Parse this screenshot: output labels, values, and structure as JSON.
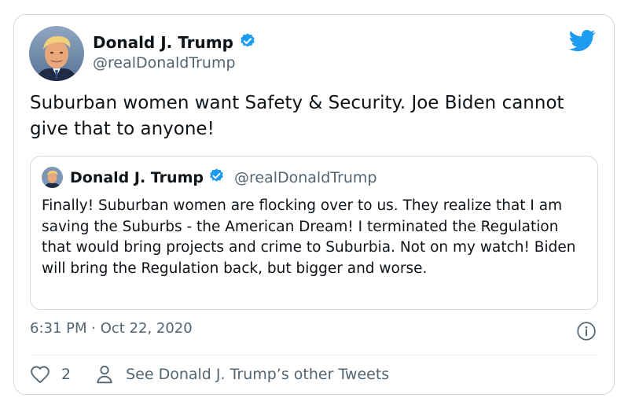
{
  "tweet": {
    "author_name": "Donald J. Trump",
    "author_handle": "@realDonaldTrump",
    "verified": true,
    "text": "Suburban women want Safety & Security. Joe Biden cannot give that to anyone!",
    "timestamp": "6:31 PM · Oct 22, 2020",
    "like_count": "2",
    "see_other_label": "See Donald J. Trump’s other Tweets"
  },
  "quoted_tweet": {
    "author_name": "Donald J. Trump",
    "author_handle": "@realDonaldTrump",
    "verified": true,
    "text": "Finally! Suburban women are flocking over to us. They realize that I am saving the Suburbs - the American Dream! I terminated the Regulation that would bring projects and crime to Suburbia. Not on my watch! Biden will bring the Regulation back, but bigger and worse."
  },
  "icons": {
    "brand": "twitter-bird-icon",
    "verified": "verified-badge-icon",
    "info": "info-icon",
    "like": "heart-icon",
    "profile": "person-icon"
  },
  "colors": {
    "brand_blue": "#1d9bf0",
    "text_primary": "#0f1419",
    "text_secondary": "#536471",
    "border": "#cfd9de"
  }
}
